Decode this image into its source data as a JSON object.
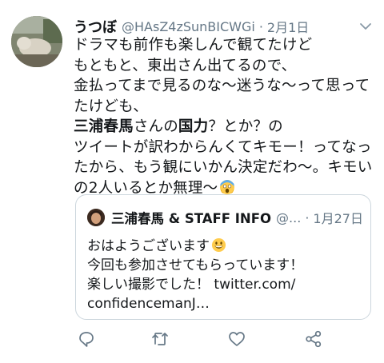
{
  "tweet": {
    "author_name": "うつぼ",
    "author_handle": "@HAsZ4zSunBICWGi",
    "separator": "·",
    "date": "2月1日",
    "text_part1": "ドラマも前作も楽しんで観てたけど\nもともと、東出さん出てるので、\n金払ってまで見るのな〜迷うな〜って思ってたけども、\n",
    "text_bold": "三浦春馬",
    "text_part2": "さんの",
    "text_bold2": "国力",
    "text_part3": "？とか？の\nツイートが訳わからんくてキモー！ってなったから、もう観にいかん決定だわ〜。キモいの2人いるとか無理〜",
    "emoji_end": "scream-emoji"
  },
  "quote": {
    "author_name": "三浦春馬 & STAFF INFO",
    "author_handle": "@...",
    "separator": "·",
    "date": "1月27日",
    "line1": "おはようございます",
    "line1_emoji": "grin-emoji",
    "line2": "今回も参加させてもらっています！\n楽しい撮影でした！ twitter.com/\nconfidencemanJ…"
  },
  "actions": {
    "icons": [
      "reply-icon",
      "retweet-icon",
      "like-icon",
      "share-icon"
    ]
  },
  "colors": {
    "text": "#14171a",
    "secondary": "#657786",
    "border": "#ccd6dd"
  }
}
